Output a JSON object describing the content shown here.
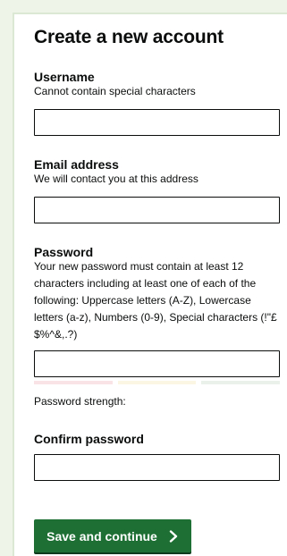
{
  "form": {
    "title": "Create a new account",
    "username": {
      "label": "Username",
      "hint": "Cannot contain special characters",
      "value": ""
    },
    "email": {
      "label": "Email address",
      "hint": "We will contact you at this address",
      "value": ""
    },
    "password": {
      "label": "Password",
      "hint": "Your new password must contain at least 12 characters including at least one of each of the following: Uppercase letters (A-Z), Lowercase letters (a-z), Numbers (0-9), Special characters (!\"£$%^&,.?)",
      "value": "",
      "strength_label": "Password strength:",
      "strength_colors": [
        "#f9e3e6",
        "#fbf6e3",
        "#e9f1ea"
      ]
    },
    "confirm": {
      "label": "Confirm password",
      "value": ""
    },
    "submit": {
      "label": "Save and continue",
      "icon": "chevron-right-icon",
      "color": "#1d6f33"
    }
  }
}
